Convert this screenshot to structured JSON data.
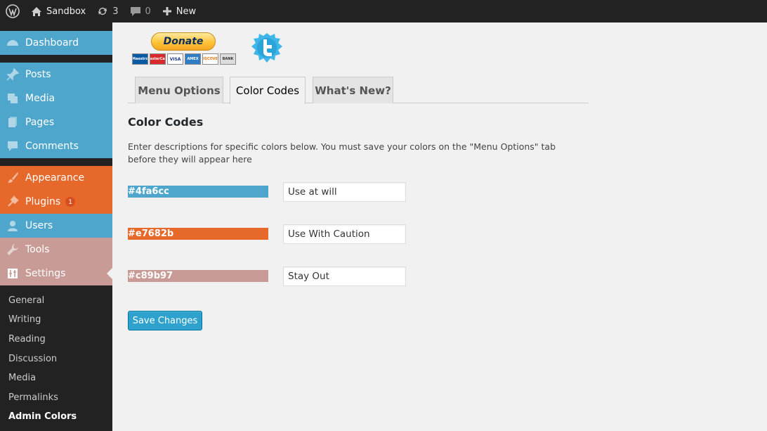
{
  "adminbar": {
    "site_name": "Sandbox",
    "updates_count": "3",
    "comments_count": "0",
    "new_label": "New",
    "icons": [
      "wordpress-logo-icon",
      "home-icon",
      "updates-icon",
      "comment-bubble-icon",
      "plus-icon"
    ]
  },
  "sidebar": {
    "items": [
      {
        "label": "Dashboard",
        "icon": "dashboard-icon"
      },
      {
        "label": "Posts",
        "icon": "pin-icon"
      },
      {
        "label": "Media",
        "icon": "media-icon"
      },
      {
        "label": "Pages",
        "icon": "pages-icon"
      },
      {
        "label": "Comments",
        "icon": "comment-icon"
      },
      {
        "label": "Appearance",
        "icon": "brush-icon"
      },
      {
        "label": "Plugins",
        "icon": "plug-icon",
        "badge": "1"
      },
      {
        "label": "Users",
        "icon": "user-icon"
      },
      {
        "label": "Tools",
        "icon": "wrench-icon"
      },
      {
        "label": "Settings",
        "icon": "settings-icon"
      }
    ],
    "submenu": [
      "General",
      "Writing",
      "Reading",
      "Discussion",
      "Media",
      "Permalinks",
      "Admin Colors"
    ],
    "current_submenu": "Admin Colors"
  },
  "donate": {
    "label": "Donate",
    "cards": [
      "Maestro",
      "MasterCard",
      "VISA",
      "AMEX",
      "DISCOVER",
      "BANK"
    ]
  },
  "tabs": [
    {
      "label": "Menu Options"
    },
    {
      "label": "Color Codes"
    },
    {
      "label": "What's New?"
    }
  ],
  "active_tab": "Color Codes",
  "main": {
    "title": "Color Codes",
    "description": "Enter descriptions for specific colors below. You must save your colors on the \"Menu Options\" tab before they will appear here",
    "colors": [
      {
        "hex": "#4fa6cc",
        "description": "Use at will"
      },
      {
        "hex": "#e7682b",
        "description": "Use With Caution"
      },
      {
        "hex": "#c89b97",
        "description": "Stay Out"
      }
    ],
    "save_label": "Save Changes"
  },
  "theme": {
    "primary": "#4fa6cc",
    "caution": "#e7682b",
    "danger": "#c89b97",
    "adminbar": "#222222",
    "button": "#2ea2cc"
  }
}
